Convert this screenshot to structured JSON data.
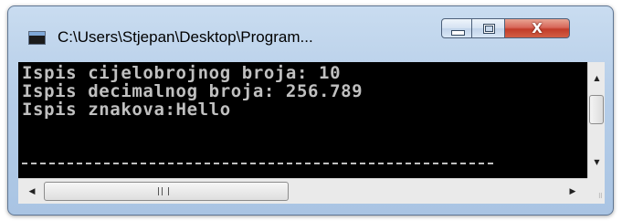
{
  "window": {
    "title": "C:\\Users\\Stjepan\\Desktop\\Program...",
    "icon": "console-app-icon",
    "buttons": {
      "minimize": "minimize-icon",
      "maximize": "maximize-icon",
      "close_glyph": "X"
    }
  },
  "console": {
    "lines": [
      "Ispis cijelobrojnog broja: 10",
      "Ispis decimalnog broja: 256.789",
      "Ispis znakova:Hello"
    ],
    "background": "#000000",
    "text_color": "#c0c0c0"
  },
  "scrollbars": {
    "vertical_up": "▲",
    "vertical_down": "▼",
    "horizontal_left": "◀",
    "horizontal_right": "▶",
    "resize_grip": "⠿"
  },
  "colors": {
    "title_bar": "#b5cde8",
    "close_button": "#c23c2a"
  }
}
